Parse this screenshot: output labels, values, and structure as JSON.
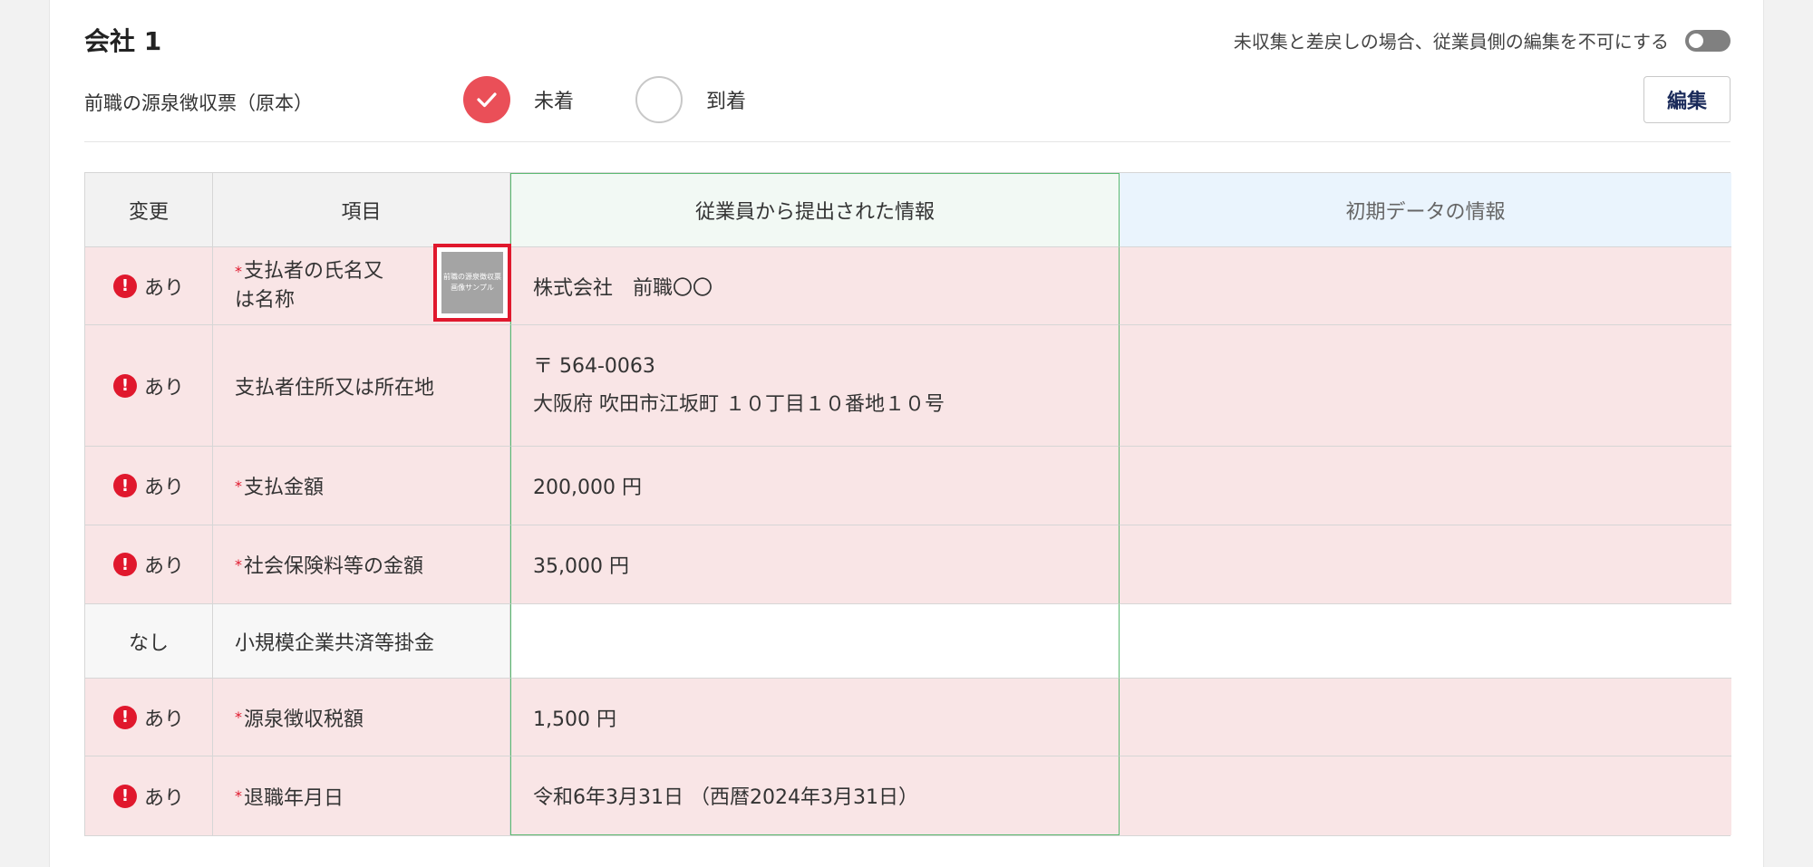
{
  "header": {
    "title": "会社 1",
    "toggle_label": "未収集と差戻しの場合、従業員側の編集を不可にする",
    "doc_label": "前職の源泉徴収票（原本）",
    "radio_not_arrived": "未着",
    "radio_arrived": "到着",
    "edit_button": "編集"
  },
  "table": {
    "headers": {
      "change": "変更",
      "item": "項目",
      "employee": "従業員から提出された情報",
      "initial": "初期データの情報"
    },
    "rows": [
      {
        "change": "あり",
        "item": "支払者の氏名又　は名称",
        "employee": "株式会社　前職〇〇",
        "initial": ""
      },
      {
        "change": "あり",
        "item": "支払者住所又は所在地",
        "employee_line1": "〒 564-0063",
        "employee_line2": "大阪府 吹田市江坂町 １０丁目１０番地１０号",
        "initial": ""
      },
      {
        "change": "あり",
        "item": "支払金額",
        "employee": "200,000 円",
        "initial": ""
      },
      {
        "change": "あり",
        "item": "社会保険料等の金額",
        "employee": "35,000 円",
        "initial": ""
      },
      {
        "change": "なし",
        "item": "小規模企業共済等掛金",
        "employee": "",
        "initial": ""
      },
      {
        "change": "あり",
        "item": "源泉徴収税額",
        "employee": "1,500 円",
        "initial": ""
      },
      {
        "change": "あり",
        "item": "退職年月日",
        "employee": "令和6年3月31日 （西暦2024年3月31日）",
        "initial": ""
      }
    ],
    "required_mark": "*",
    "alert_glyph": "!",
    "thumbnail_line1": "前職の源泉徴収票",
    "thumbnail_line2": "画像サンプル"
  },
  "colors": {
    "accent_red": "#ea4f58",
    "alert_red": "#e0182d",
    "changed_row_bg": "#f9e5e6",
    "employee_border": "#5cba72",
    "initial_header_bg": "#eaf4fd"
  }
}
